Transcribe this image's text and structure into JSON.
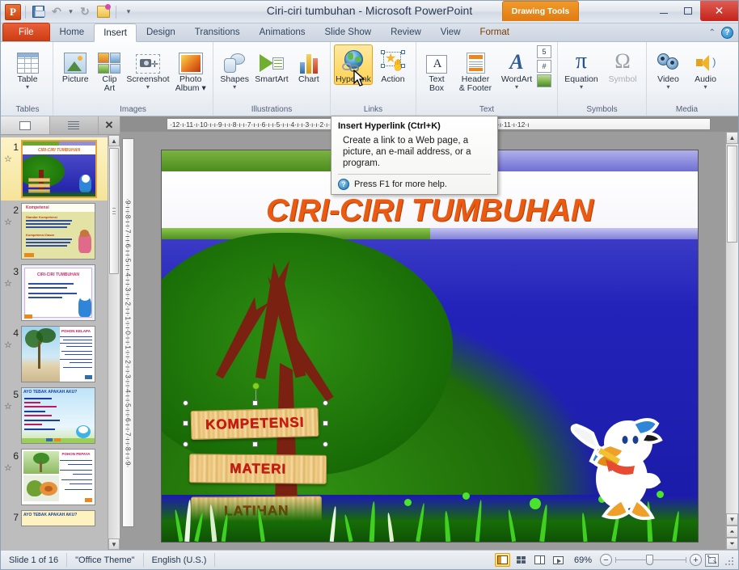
{
  "window": {
    "title": "Ciri-ciri tumbuhan  -  Microsoft PowerPoint",
    "contextual_tools": "Drawing Tools",
    "minimize": "–",
    "restore": "▢",
    "close": "✕"
  },
  "quick_access": [
    {
      "name": "powerpoint-logo",
      "label": "P"
    },
    {
      "name": "save-icon",
      "label": ""
    },
    {
      "name": "undo-icon",
      "label": "↶"
    },
    {
      "name": "redo-icon",
      "label": "↻"
    },
    {
      "name": "start-slideshow-icon",
      "label": ""
    },
    {
      "name": "customize-qat-icon",
      "label": "▾"
    }
  ],
  "tabs": [
    {
      "label": "File",
      "type": "file"
    },
    {
      "label": "Home",
      "type": "normal"
    },
    {
      "label": "Insert",
      "type": "active"
    },
    {
      "label": "Design",
      "type": "normal"
    },
    {
      "label": "Transitions",
      "type": "normal"
    },
    {
      "label": "Animations",
      "type": "normal"
    },
    {
      "label": "Slide Show",
      "type": "normal"
    },
    {
      "label": "Review",
      "type": "normal"
    },
    {
      "label": "View",
      "type": "normal"
    },
    {
      "label": "Format",
      "type": "contextual"
    }
  ],
  "tab_right": {
    "collapse_ribbon": "⌃",
    "help": "?"
  },
  "ribbon": {
    "groups": [
      {
        "name": "tables",
        "label": "Tables",
        "buttons": [
          {
            "name": "table-button",
            "label": "Table",
            "caret": "▾",
            "icon": "table-icon"
          }
        ]
      },
      {
        "name": "images",
        "label": "Images",
        "buttons": [
          {
            "name": "picture-button",
            "label": "Picture",
            "caret": "",
            "icon": "picture-icon"
          },
          {
            "name": "clip-art-button",
            "label": "Clip\nArt",
            "caret": "",
            "icon": "clip-art-icon"
          },
          {
            "name": "screenshot-button",
            "label": "Screenshot",
            "caret": "▾",
            "icon": "screenshot-icon"
          },
          {
            "name": "photo-album-button",
            "label": "Photo\nAlbum ▾",
            "caret": "",
            "icon": "photo-album-icon"
          }
        ]
      },
      {
        "name": "illustrations",
        "label": "Illustrations",
        "buttons": [
          {
            "name": "shapes-button",
            "label": "Shapes",
            "caret": "▾",
            "icon": "shapes-icon"
          },
          {
            "name": "smartart-button",
            "label": "SmartArt",
            "caret": "",
            "icon": "smartart-icon"
          },
          {
            "name": "chart-button",
            "label": "Chart",
            "caret": "",
            "icon": "chart-icon"
          }
        ]
      },
      {
        "name": "links",
        "label": "Links",
        "buttons": [
          {
            "name": "hyperlink-button",
            "label": "Hyperlink",
            "caret": "",
            "icon": "hyperlink-icon",
            "state": "hover"
          },
          {
            "name": "action-button",
            "label": "Action",
            "caret": "",
            "icon": "action-icon"
          }
        ]
      },
      {
        "name": "text",
        "label": "Text",
        "buttons": [
          {
            "name": "text-box-button",
            "label": "Text\nBox",
            "caret": "",
            "icon": "text-box-icon"
          },
          {
            "name": "header-footer-button",
            "label": "Header\n& Footer",
            "caret": "",
            "icon": "header-footer-icon"
          },
          {
            "name": "wordart-button",
            "label": "WordArt",
            "caret": "▾",
            "icon": "wordart-icon"
          }
        ],
        "small_buttons": [
          {
            "name": "date-time-button",
            "label": "5"
          },
          {
            "name": "slide-number-button",
            "label": "#"
          },
          {
            "name": "object-button",
            "label": ""
          }
        ]
      },
      {
        "name": "symbols",
        "label": "Symbols",
        "buttons": [
          {
            "name": "equation-button",
            "label": "Equation",
            "caret": "▾",
            "icon": "equation-icon"
          },
          {
            "name": "symbol-button",
            "label": "Symbol",
            "caret": "",
            "icon": "symbol-icon",
            "state": "disabled"
          }
        ]
      },
      {
        "name": "media",
        "label": "Media",
        "buttons": [
          {
            "name": "video-button",
            "label": "Video",
            "caret": "▾",
            "icon": "video-icon"
          },
          {
            "name": "audio-button",
            "label": "Audio",
            "caret": "▾",
            "icon": "audio-icon"
          }
        ]
      }
    ]
  },
  "tooltip": {
    "title": "Insert Hyperlink (Ctrl+K)",
    "body": "Create a link to a Web page, a picture, an e-mail address, or a program.",
    "footer": "Press F1 for more help.",
    "help_glyph": "?"
  },
  "thumb_pane": {
    "tab_slides": "slides-tab-icon",
    "tab_outline": "outline-tab-icon",
    "close": "✕",
    "slides": [
      {
        "number": "1",
        "title": "CIRI-CIRI TUMBUHAN",
        "selected": true
      },
      {
        "number": "2",
        "title": "Kompetensi",
        "selected": false
      },
      {
        "number": "3",
        "title": "CIRI-CIRI TUMBUHAN",
        "selected": false
      },
      {
        "number": "4",
        "title": "POHON KELAPA",
        "selected": false
      },
      {
        "number": "5",
        "title": "AYO TEBAK APAKAH AKU?",
        "selected": false
      },
      {
        "number": "6",
        "title": "POHON PEPAYA",
        "selected": false
      },
      {
        "number": "7",
        "title": "AYO TEBAK APAKAH AKU?",
        "selected": false
      }
    ]
  },
  "rulers": {
    "horizontal": "·12·ı·11·ı·10·ı·ı·9·ı·ı·8·ı·ı·7·ı·ı·6·ı·ı·5·ı·ı·4·ı·ı·3·ı·ı·2·ı·ı·1·ı·ı·0·ı·ı·1·ı·ı·2·ı·ı·3·ı·ı·4·ı·ı·5·ı·ı·6·ı·ı·7·ı·ı·8·ı·ı·9·ı·10·ı·11·ı·12·ı",
    "vertical": "·9·ı·ı·8·ı·ı·7·ı·ı·6·ı·ı·5·ı·ı·4·ı·ı·3·ı·ı·2·ı·ı·1·ı·ı·0·ı·ı·1·ı·ı·2·ı·ı·3·ı·ı·4·ı·ı·5·ı·ı·6·ı·ı·7·ı·ı·8·ı·ı·9·"
  },
  "slide": {
    "title": "CIRI-CIRI TUMBUHAN",
    "title_color": "#ea5a10",
    "signs": [
      {
        "name": "sign-kompetensi",
        "label": "KOMPETENSI",
        "selected": true
      },
      {
        "name": "sign-materi",
        "label": "MATERI",
        "selected": false
      },
      {
        "name": "sign-latihan",
        "label": "LATIHAN",
        "selected": false
      }
    ],
    "character": "donald-duck-image"
  },
  "scroll": {
    "up": "▲",
    "down": "▼",
    "prev_slide": "⏶",
    "next_slide": "⏷"
  },
  "status_bar": {
    "slide_indicator": "Slide 1 of 16",
    "theme": "\"Office Theme\"",
    "language": "English (U.S.)",
    "zoom_level": "69%",
    "zoom_out": "−",
    "zoom_in": "+",
    "views": [
      {
        "name": "view-normal",
        "label": "normal-view-icon",
        "active": true
      },
      {
        "name": "view-slide-sorter",
        "label": "slide-sorter-icon",
        "active": false
      },
      {
        "name": "view-reading",
        "label": "reading-view-icon",
        "active": false
      },
      {
        "name": "view-slideshow",
        "label": "slideshow-icon",
        "active": false
      }
    ],
    "fit_button": "fit-slide-to-window-icon"
  }
}
